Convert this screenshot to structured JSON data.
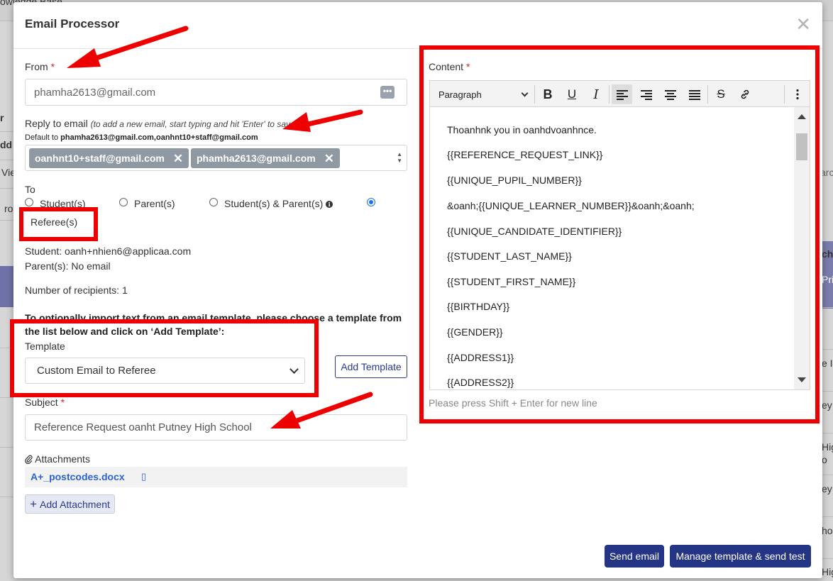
{
  "background": {
    "top_left_text": "owledge Base",
    "left_fragments": [
      "r",
      "dd",
      "Vie",
      "ro"
    ],
    "right_fragments": [
      "arc",
      "cho",
      "Pri",
      "e In",
      "eyı",
      "Hig",
      "o",
      "eyı",
      "ho",
      "Hig"
    ]
  },
  "modal": {
    "title": "Email Processor",
    "close_label": "✕"
  },
  "from": {
    "label": "From",
    "required_mark": "*",
    "value": "phamha2613@gmail.com"
  },
  "reply": {
    "label": "Reply to email",
    "hint": "(to add a new email, start typing and hit 'Enter' to save)",
    "default_prefix": "Default to",
    "default_value": "phamha2613@gmail.com,oanhnt10+staff@gmail.com",
    "tags": [
      "oanhnt10+staff@gmail.com",
      "phamha2613@gmail.com"
    ]
  },
  "to": {
    "label": "To",
    "options": [
      "Student(s)",
      "Parent(s)",
      "Student(s) & Parent(s)",
      "Referee(s)"
    ],
    "selected": "Referee(s)"
  },
  "recipients": {
    "student_line": "Student: oanh+nhien6@applicaa.com",
    "parent_line": "Parent(s): No email",
    "count_line": "Number of recipients: 1"
  },
  "template": {
    "instruction": "To optionally import text from an email template, please choose a template from the list below and click on ‘Add Template’:",
    "label": "Template",
    "selected": "Custom Email to Referee",
    "add_button": "Add Template"
  },
  "subject": {
    "label": "Subject",
    "required_mark": "*",
    "value": "Reference Request oanht Putney High School"
  },
  "attachments": {
    "label": "Attachments",
    "file_name": "A+_postcodes.docx",
    "file_icon": "▯",
    "add_button": "Add Attachment"
  },
  "content": {
    "label": "Content",
    "required_mark": "*",
    "paragraph_select": "Paragraph",
    "lines": [
      "Thoanhnk you in oanhdvoanhnce.",
      "{{REFERENCE_REQUEST_LINK}}",
      "{{UNIQUE_PUPIL_NUMBER}}",
      "&oanh;{{UNIQUE_LEARNER_NUMBER}}&oanh;&oanh;",
      "{{UNIQUE_CANDIDATE_IDENTIFIER}}",
      "{{STUDENT_LAST_NAME}}",
      "{{STUDENT_FIRST_NAME}}",
      "{{BIRTHDAY}}",
      "{{GENDER}}",
      "{{ADDRESS1}}",
      "{{ADDRESS2}}"
    ],
    "footer_hint": "Please press Shift + Enter for new line"
  },
  "footer": {
    "send_button": "Send email",
    "manage_button": "Manage template & send test"
  },
  "colors": {
    "annotation_red": "#ee0000",
    "primary_button": "#253586",
    "tag_grey": "#8f99a3",
    "radio_blue": "#1a73e8"
  }
}
